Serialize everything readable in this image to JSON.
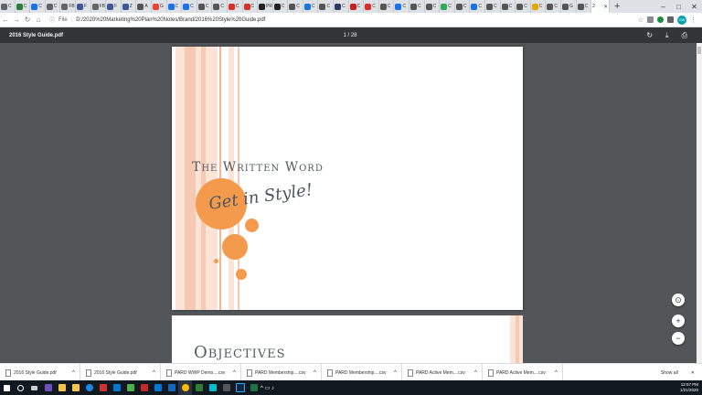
{
  "browser": {
    "tabs": [
      {
        "label": "C",
        "color": "#5f6368"
      },
      {
        "label": "C",
        "color": "#2d7d3a"
      },
      {
        "label": "C",
        "color": "#1a73e8"
      },
      {
        "label": "C",
        "color": "#5f6368"
      },
      {
        "label": "FB",
        "color": "#666"
      },
      {
        "label": "F",
        "color": "#3b5998"
      },
      {
        "label": "FB",
        "color": "#666"
      },
      {
        "label": "F",
        "color": "#3b5998"
      },
      {
        "label": "Z",
        "color": "#3b5998"
      },
      {
        "label": "A",
        "color": "#555"
      },
      {
        "label": "G",
        "color": "#ea4335"
      },
      {
        "label": "C",
        "color": "#1a73e8"
      },
      {
        "label": "C",
        "color": "#1a73e8"
      },
      {
        "label": "C",
        "color": "#555"
      },
      {
        "label": "C",
        "color": "#555"
      },
      {
        "label": "C",
        "color": "#d93025"
      },
      {
        "label": "C",
        "color": "#d93025"
      },
      {
        "label": "PR",
        "color": "#222"
      },
      {
        "label": "C",
        "color": "#222"
      },
      {
        "label": "C",
        "color": "#555"
      },
      {
        "label": "C",
        "color": "#1a73e8"
      },
      {
        "label": "C",
        "color": "#555"
      },
      {
        "label": "C",
        "color": "#2b3a67"
      },
      {
        "label": "C",
        "color": "#c5221f"
      },
      {
        "label": "C",
        "color": "#d93025"
      },
      {
        "label": "C",
        "color": "#555"
      },
      {
        "label": "C",
        "color": "#1a73e8"
      },
      {
        "label": "C",
        "color": "#555"
      },
      {
        "label": "C",
        "color": "#555"
      },
      {
        "label": "C",
        "color": "#34a853"
      },
      {
        "label": "C",
        "color": "#555"
      },
      {
        "label": "C",
        "color": "#1a73e8"
      },
      {
        "label": "C",
        "color": "#555"
      },
      {
        "label": "C",
        "color": "#555"
      },
      {
        "label": "C",
        "color": "#555"
      },
      {
        "label": "C",
        "color": "#e0a800"
      },
      {
        "label": "C",
        "color": "#555"
      },
      {
        "label": "G",
        "color": "#555"
      },
      {
        "label": "C",
        "color": "#555"
      }
    ],
    "active_tab": "2",
    "new_tab": "+",
    "window_controls": [
      "–",
      "□",
      "✕"
    ],
    "address": {
      "scheme": "File",
      "url": "D:/2020%20Marketing%20Plan%20Notes/Brand/2016%20Style%20Guide.pdf"
    },
    "nav": {
      "back": "←",
      "forward": "→",
      "reload": "↻",
      "home": "⌂"
    },
    "profile_initials": "GW"
  },
  "pdf": {
    "title": "2016 Style Guide.pdf",
    "page_indicator": "1 / 28",
    "page1": {
      "heading": "The Written Word",
      "tagline": "Get in Style!"
    },
    "page2": {
      "heading": "Objectives"
    }
  },
  "colors": {
    "accent": "#f39a4c",
    "stripe": "#f6c9b3",
    "text": "#555b63"
  },
  "fabs": {
    "fit": "⊙",
    "zoom_in": "+",
    "zoom_out": "−"
  },
  "downloads": {
    "items": [
      {
        "name": "2016 Style Guide.pdf"
      },
      {
        "name": "2016 Style Guide.pdf"
      },
      {
        "name": "PARD WWP Demo....csv"
      },
      {
        "name": "PARD Membership....csv"
      },
      {
        "name": "PARD Membership....csv"
      },
      {
        "name": "PARD Active Mem....csv"
      },
      {
        "name": "PARD Active Mem....csv"
      }
    ],
    "show_all": "Show all",
    "close": "✕"
  },
  "taskbar": {
    "time": "12:57 PM",
    "date": "1/21/2020"
  }
}
